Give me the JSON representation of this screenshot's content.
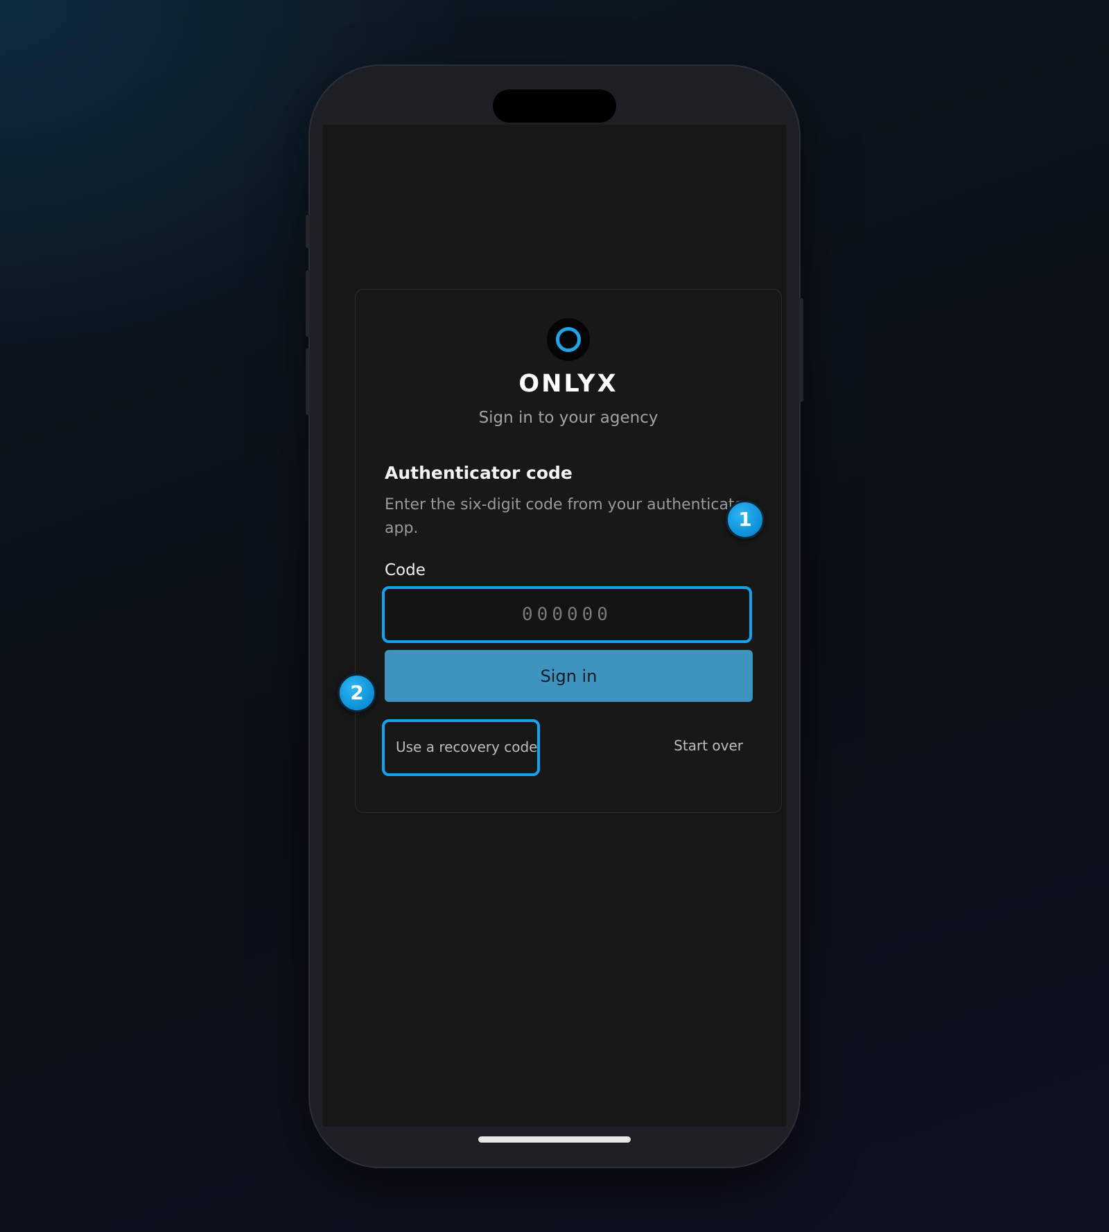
{
  "app": {
    "brand": "ONLYX",
    "tagline": "Sign in to your agency"
  },
  "auth": {
    "title": "Authenticator code",
    "description": "Enter the six-digit code from your authenticator app.",
    "code_label": "Code",
    "code_placeholder": "000000",
    "code_value": "",
    "signin_label": "Sign in",
    "recovery_label": "Use a recovery code",
    "start_over_label": "Start over"
  },
  "annotations": [
    {
      "number": "1",
      "target": "code-input"
    },
    {
      "number": "2",
      "target": "recovery-code-link"
    }
  ],
  "colors": {
    "accent": "#16a3ea",
    "button": "#3f93bf",
    "screen_bg": "#171717"
  },
  "icons": {
    "logo": "onlyx-ring-logo-icon"
  }
}
